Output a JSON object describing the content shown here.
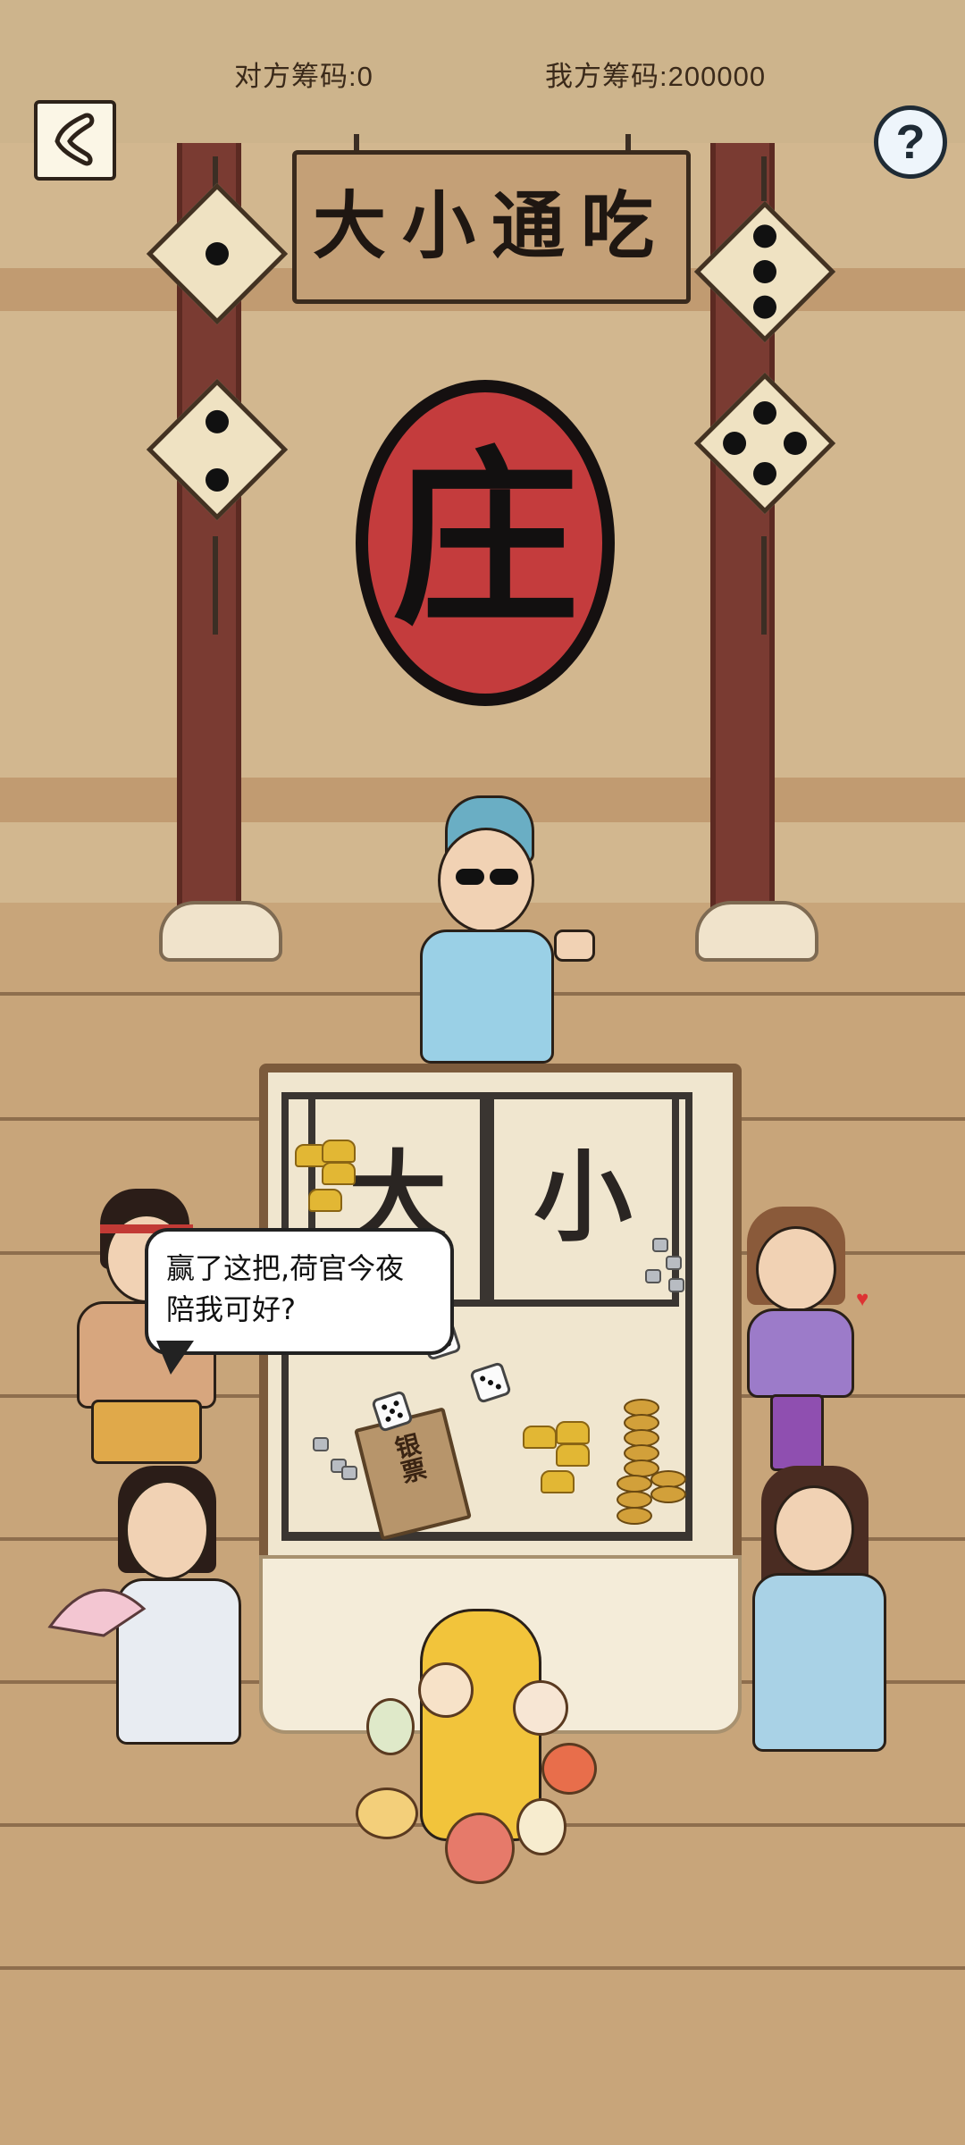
{
  "hud": {
    "opponent_chips": "对方筹码:0",
    "my_chips": "我方筹码:200000"
  },
  "controls": {
    "back_icon": "back-arrow-icon",
    "help_label": "?"
  },
  "scene": {
    "sign_text": "大小通吃",
    "banker_seal": "庄",
    "board_big": "大",
    "board_small": "小",
    "notes_label": "银票"
  },
  "dialogue": {
    "speech": "赢了这把,荷官今夜陪我可好?"
  },
  "colors": {
    "wall": "#d2b78f",
    "floor": "#c8a57a",
    "pillar": "#7a3b32",
    "seal_red": "#c43c3d",
    "table_cloth": "#f0e6cf"
  }
}
